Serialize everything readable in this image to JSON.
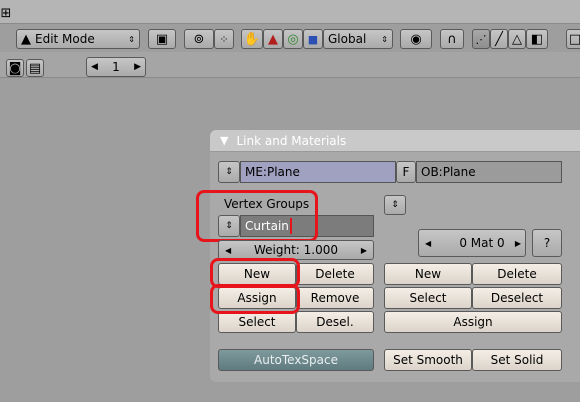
{
  "header": {
    "mode_label": "Edit Mode",
    "orientation_label": "Global",
    "frame_value": "1"
  },
  "panel": {
    "title": "Link and Materials",
    "mesh_field": "ME:Plane",
    "f_button": "F",
    "object_field": "OB:Plane",
    "vertex_groups": {
      "label": "Vertex Groups",
      "group_name": "Curtain",
      "weight_label": "Weight: 1.000",
      "new": "New",
      "delete": "Delete",
      "assign": "Assign",
      "remove": "Remove",
      "select": "Select",
      "deselect": "Desel."
    },
    "materials": {
      "mat_counter": "0 Mat 0",
      "help": "?",
      "new": "New",
      "delete": "Delete",
      "select": "Select",
      "deselect": "Deselect",
      "assign": "Assign"
    },
    "autotexspace": "AutoTexSpace",
    "set_smooth": "Set Smooth",
    "set_solid": "Set Solid"
  },
  "colors": {
    "highlight_outline": "#e8141b",
    "viewport_bg": "#9e9e9e"
  }
}
